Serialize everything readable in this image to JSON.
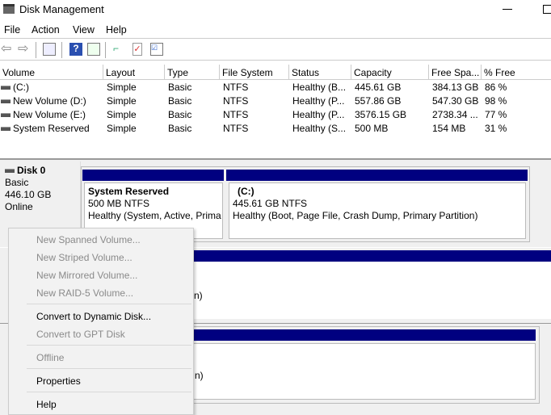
{
  "window": {
    "title": "Disk Management"
  },
  "menu": [
    "File",
    "Action",
    "View",
    "Help"
  ],
  "columns": [
    "Volume",
    "Layout",
    "Type",
    "File System",
    "Status",
    "Capacity",
    "Free Spa...",
    "% Free"
  ],
  "rows": [
    [
      "(C:)",
      "Simple",
      "Basic",
      "NTFS",
      "Healthy (B...",
      "445.61 GB",
      "384.13 GB",
      "86 %"
    ],
    [
      "New Volume (D:)",
      "Simple",
      "Basic",
      "NTFS",
      "Healthy (P...",
      "557.86 GB",
      "547.30 GB",
      "98 %"
    ],
    [
      "New Volume (E:)",
      "Simple",
      "Basic",
      "NTFS",
      "Healthy (P...",
      "3576.15 GB",
      "2738.34 ...",
      "77 %"
    ],
    [
      "System Reserved",
      "Simple",
      "Basic",
      "NTFS",
      "Healthy (S...",
      "500 MB",
      "154 MB",
      "31 %"
    ]
  ],
  "disk0": {
    "name": "Disk 0",
    "type": "Basic",
    "size": "446.10 GB",
    "status": "Online",
    "partitions": [
      {
        "name": "System Reserved",
        "size": "500 MB NTFS",
        "status": "Healthy (System, Active, Prima"
      },
      {
        "name": "(C:)",
        "size": "445.61 GB NTFS",
        "status": "Healthy (Boot, Page File, Crash Dump, Primary Partition)"
      }
    ]
  },
  "partial": {
    "d1": "n)",
    "d2": "n)"
  },
  "context_menu": {
    "items": [
      "New Spanned Volume...",
      "New Striped Volume...",
      "New Mirrored Volume...",
      "New RAID-5 Volume...",
      "Convert to Dynamic Disk...",
      "Convert to GPT Disk",
      "Offline",
      "Properties",
      "Help"
    ]
  },
  "colors": {
    "partition_bar": "#000080"
  }
}
